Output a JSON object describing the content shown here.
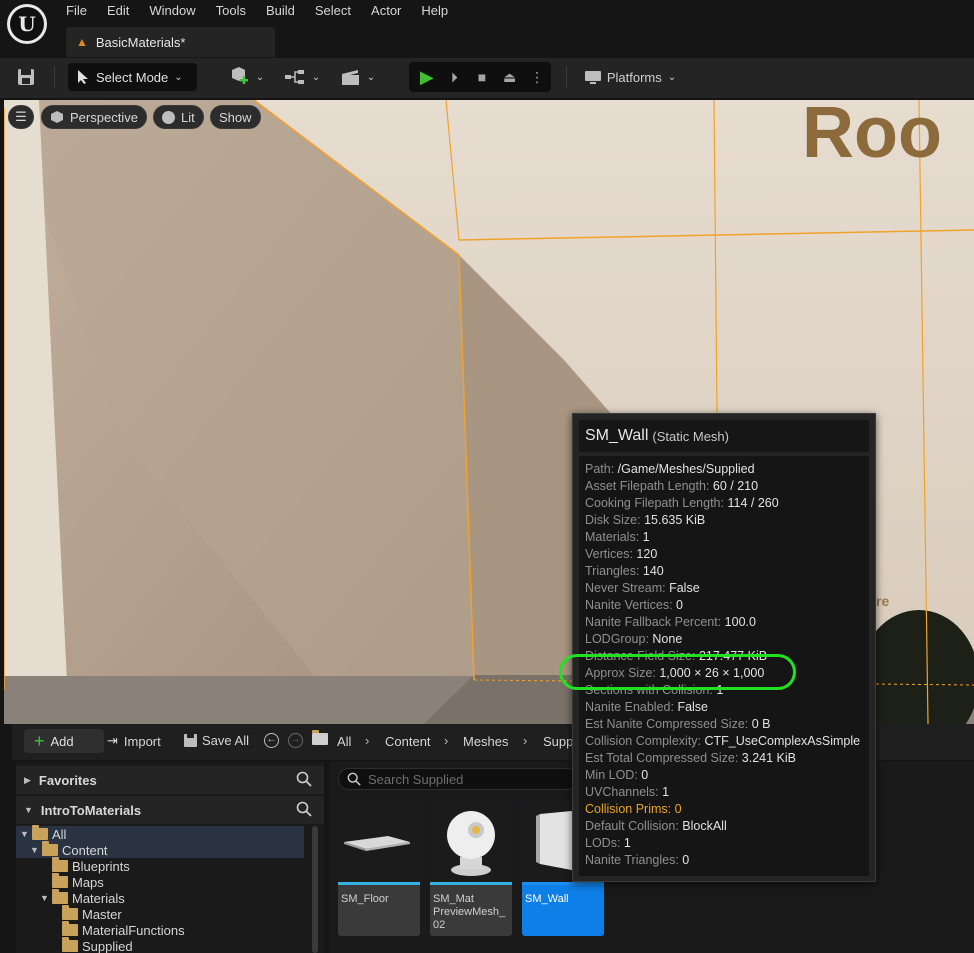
{
  "app": {
    "logo_text": "U",
    "menu": [
      "File",
      "Edit",
      "Window",
      "Tools",
      "Build",
      "Select",
      "Actor",
      "Help"
    ],
    "document_tab": "BasicMaterials*"
  },
  "toolbar": {
    "select_mode": "Select Mode",
    "platforms": "Platforms"
  },
  "viewport": {
    "perspective": "Perspective",
    "lit": "Lit",
    "show": "Show",
    "scene_sign_text": "Roo",
    "scene_small_text": "re"
  },
  "content_browser": {
    "add": "Add",
    "import": "Import",
    "save_all": "Save All",
    "breadcrumbs": [
      "All",
      "Content",
      "Meshes",
      "Supp"
    ],
    "favorites": "Favorites",
    "project": "IntroToMaterials",
    "search_placeholder": "Search Supplied",
    "tree": [
      {
        "label": "All"
      },
      {
        "label": "Content"
      },
      {
        "label": "Blueprints"
      },
      {
        "label": "Maps"
      },
      {
        "label": "Materials"
      },
      {
        "label": "Master"
      },
      {
        "label": "MaterialFunctions"
      },
      {
        "label": "Supplied"
      }
    ],
    "assets": [
      {
        "label": "SM_Floor"
      },
      {
        "label": "SM_Mat PreviewMesh_ 02"
      },
      {
        "label": "SM_Wall"
      }
    ]
  },
  "tooltip": {
    "name": "SM_Wall",
    "type": "(Static Mesh)",
    "rows": [
      {
        "k": "Path:",
        "v": "/Game/Meshes/Supplied"
      },
      {
        "k": "Asset Filepath Length:",
        "v": "60 / 210"
      },
      {
        "k": "Cooking Filepath Length:",
        "v": "114 / 260"
      },
      {
        "k": "Disk Size:",
        "v": "15.635 KiB"
      },
      {
        "k": "Materials:",
        "v": "1"
      },
      {
        "k": "Vertices:",
        "v": "120"
      },
      {
        "k": "Triangles:",
        "v": "140"
      },
      {
        "k": "Never Stream:",
        "v": "False"
      },
      {
        "k": "Nanite Vertices:",
        "v": "0"
      },
      {
        "k": "Nanite Fallback Percent:",
        "v": "100.0"
      },
      {
        "k": "LODGroup:",
        "v": "None"
      },
      {
        "k": "Distance Field Size:",
        "v": "217.477 KiB"
      },
      {
        "k": "Approx Size:",
        "v": "1,000 × 26 × 1,000"
      },
      {
        "k": "Sections with Collision:",
        "v": "1"
      },
      {
        "k": "Nanite Enabled:",
        "v": "False"
      },
      {
        "k": "Est Nanite Compressed Size:",
        "v": "0 B"
      },
      {
        "k": "Collision Complexity:",
        "v": "CTF_UseComplexAsSimple"
      },
      {
        "k": "Est Total Compressed Size:",
        "v": "3.241 KiB"
      },
      {
        "k": "Min LOD:",
        "v": "0"
      },
      {
        "k": "UVChannels:",
        "v": "1"
      },
      {
        "k": "Collision Prims:",
        "v": "0"
      },
      {
        "k": "Default Collision:",
        "v": "BlockAll"
      },
      {
        "k": "LODs:",
        "v": "1"
      },
      {
        "k": "Nanite Triangles:",
        "v": "0"
      }
    ]
  },
  "colors": {
    "accent_selection": "#0f7fe8",
    "highlight_ring": "#22e022",
    "warning_text": "#e8a421",
    "play_green": "#3fbf2f"
  }
}
